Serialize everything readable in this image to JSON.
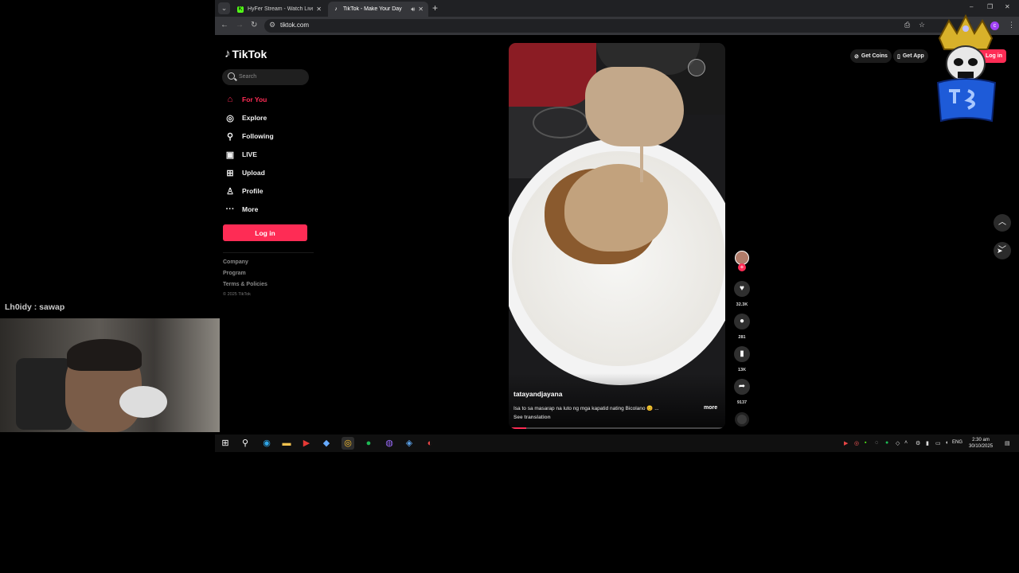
{
  "browser": {
    "tabs": [
      {
        "title": "HyFer Stream - Watch Live on |",
        "icon": "kick-icon",
        "color": "#53fc18"
      },
      {
        "title": "TikTok - Make Your Day",
        "icon": "tiktok-icon",
        "active": true
      }
    ],
    "url": "tiktok.com",
    "profile_initial": "c"
  },
  "sidebar": {
    "logo": "TikTok",
    "search_placeholder": "Search",
    "menu": [
      {
        "label": "For You",
        "icon": "home-icon",
        "active": true
      },
      {
        "label": "Explore",
        "icon": "compass-icon"
      },
      {
        "label": "Following",
        "icon": "following-icon"
      },
      {
        "label": "LIVE",
        "icon": "live-icon"
      },
      {
        "label": "Upload",
        "icon": "upload-icon"
      },
      {
        "label": "Profile",
        "icon": "profile-icon"
      },
      {
        "label": "More",
        "icon": "more-icon"
      }
    ],
    "login_label": "Log in",
    "footer_links": [
      "Company",
      "Program",
      "Terms & Policies"
    ],
    "copyright": "© 2025 TikTok"
  },
  "video": {
    "username": "tatayandjayana",
    "caption": "Isa to sa masarap na luto ng mga kapatid nating Bicolano 😊 ...",
    "more_label": "more",
    "translation_label": "See translation",
    "progress": 0.08
  },
  "actions": {
    "likes": "32.3K",
    "comments": "281",
    "saves": "13K",
    "shares": "9137"
  },
  "topbar": {
    "get_coins": "Get Coins",
    "get_app": "Get App",
    "login": "Log in"
  },
  "stream": {
    "chat_user": "Lh0idy",
    "chat_message": "sawap",
    "chat_line": "Lh0idy : sawap"
  },
  "taskbar": {
    "lang": "ENG",
    "time": "2:30 am",
    "date": "30/10/2025"
  },
  "colors": {
    "accent": "#fe2c55",
    "background": "#000000",
    "chrome_bg": "#202124"
  }
}
